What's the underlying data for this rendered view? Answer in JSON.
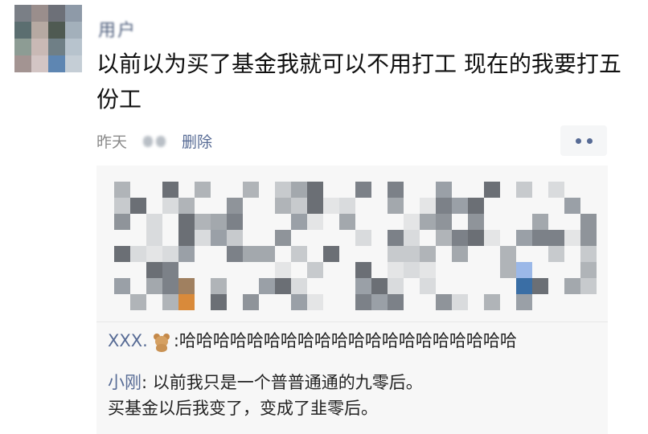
{
  "post": {
    "username": "用户",
    "text": "以前以为买了基金我就可以不用打工 现在的我要打五份工",
    "time": "昨天",
    "delete_label": "删除"
  },
  "comments": [
    {
      "name": "XXX.",
      "text": ":哈哈哈哈哈哈哈哈哈哈哈哈哈哈哈哈哈哈哈哈"
    },
    {
      "name": "小刚",
      "text": ": 以前我只是一个普普通通的九零后。",
      "text2": "买基金以后我变了，变成了韭零后。"
    }
  ],
  "colors": {
    "link": "#576b95",
    "panel": "#f7f7f7"
  },
  "icons": {
    "more": "more-dots-icon",
    "visibility": "friends-visibility-icon",
    "emoji": "teddy-bear-icon"
  }
}
